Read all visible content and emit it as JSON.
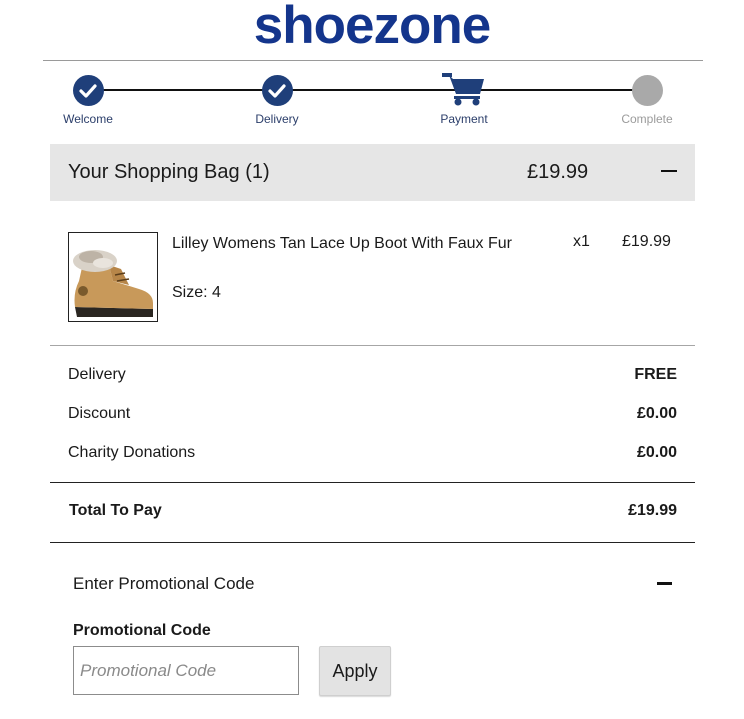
{
  "brand": {
    "logo_text": "shoezone",
    "color": "#14358c"
  },
  "progress": {
    "steps": [
      {
        "label": "Welcome",
        "state": "done",
        "icon": "check-icon"
      },
      {
        "label": "Delivery",
        "state": "done",
        "icon": "check-icon"
      },
      {
        "label": "Payment",
        "state": "current",
        "icon": "cart-icon"
      },
      {
        "label": "Complete",
        "state": "pending",
        "icon": "circle-icon"
      }
    ]
  },
  "bag": {
    "title": "Your Shopping Bag (1)",
    "total": "£19.99",
    "collapse_icon": "minus-icon"
  },
  "product": {
    "name": "Lilley Womens Tan Lace Up Boot With Faux Fur",
    "size": "Size: 4",
    "qty": "x1",
    "price": "£19.99",
    "image": "tan-boot-image"
  },
  "summary": {
    "rows": [
      {
        "label": "Delivery",
        "value": "FREE"
      },
      {
        "label": "Discount",
        "value": "£0.00"
      },
      {
        "label": "Charity Donations",
        "value": "£0.00"
      }
    ],
    "total_label": "Total To Pay",
    "total_value": "£19.99"
  },
  "promo": {
    "heading": "Enter Promotional Code",
    "label": "Promotional Code",
    "placeholder": "Promotional Code",
    "value": "",
    "apply_label": "Apply"
  },
  "colors": {
    "step_done": "#1f3f7a",
    "step_pending": "#a9a9a9",
    "bag_header_bg": "#e6e6e6"
  }
}
